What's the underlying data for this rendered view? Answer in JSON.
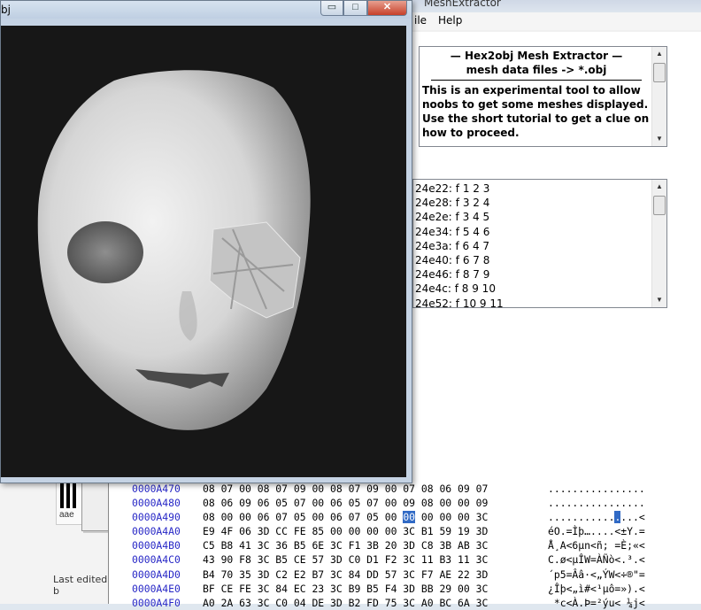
{
  "viewer": {
    "title": "bj",
    "minimize_glyph": "▭",
    "maximize_glyph": "□",
    "close_glyph": "✕"
  },
  "mesh_extractor": {
    "title": "MeshExtractor",
    "menu": {
      "file": "ile",
      "help": "Help"
    },
    "info": {
      "header_line1": "—    Hex2obj Mesh Extractor    —",
      "header_line2": "mesh data files -> *.obj",
      "body_lines": [
        "This is an experimental tool to allow",
        "noobs to get some meshes displayed.",
        "Use the short tutorial to get a clue on",
        "how to proceed."
      ]
    },
    "faces": [
      "24e22: f  1 2 3",
      "24e28: f  3 2 4",
      "24e2e: f  3 4 5",
      "24e34: f  5 4 6",
      "24e3a: f  6 4 7",
      "24e40: f  6 7 8",
      "24e46: f  8 7 9",
      "24e4c: f  8 9 10",
      "24e52: f  10 9 11"
    ]
  },
  "hex_editor": {
    "rows": [
      {
        "addr": "0000A470",
        "pre": "08 07 00 08 07 09 00 08 07 09 00 07 08 06 09 07",
        "sel": "",
        "post": "",
        "ascii_pre": "................",
        "ascii_sel": "",
        "ascii_post": ""
      },
      {
        "addr": "0000A480",
        "pre": "08 06 09 06 05 07 00 06 05 07 00 09 08 00 00 09",
        "sel": "",
        "post": "",
        "ascii_pre": "................",
        "ascii_sel": "",
        "ascii_post": ""
      },
      {
        "addr": "0000A490",
        "pre": "08 00 00 06 07 05 00 06 07 05 00 ",
        "sel": "00",
        "post": " 00 00 00 3C",
        "ascii_pre": "...........",
        "ascii_sel": ".",
        "ascii_post": "...<"
      },
      {
        "addr": "0000A4A0",
        "pre": "E9 4F 06 3D CC FE 85 00 00 00 00 3C B1 59 19 3D",
        "sel": "",
        "post": "",
        "ascii_pre": "éO.=Ìþ…....<±Y.=",
        "ascii_sel": "",
        "ascii_post": ""
      },
      {
        "addr": "0000A4B0",
        "pre": "C5 B8 41 3C 36 B5 6E 3C F1 3B 20 3D C8 3B AB 3C",
        "sel": "",
        "post": "",
        "ascii_pre": "Å¸A<6µn<ñ; =È;«<",
        "ascii_sel": "",
        "ascii_post": ""
      },
      {
        "addr": "0000A4C0",
        "pre": "43 90 F8 3C B5 CE 57 3D C0 D1 F2 3C 11 B3 11 3C",
        "sel": "",
        "post": "",
        "ascii_pre": "C.ø<µÎW=ÀÑò<.³.<",
        "ascii_sel": "",
        "ascii_post": ""
      },
      {
        "addr": "0000A4D0",
        "pre": "B4 70 35 3D C2 E2 B7 3C 84 DD 57 3C F7 AE 22 3D",
        "sel": "",
        "post": "",
        "ascii_pre": "´p5=Ââ·<„ÝW<÷®\"=",
        "ascii_sel": "",
        "ascii_post": ""
      },
      {
        "addr": "0000A4E0",
        "pre": "BF CE FE 3C 84 EC 23 3C B9 B5 F4 3D BB 29 00 3C",
        "sel": "",
        "post": "",
        "ascii_pre": "¿Îþ<„ì#<¹µô=»).<",
        "ascii_sel": "",
        "ascii_post": ""
      },
      {
        "addr": "0000A4F0",
        "pre": "A0 2A 63 3C C0 04 DE 3D B2 FD 75 3C A0 BC 6A 3C",
        "sel": "",
        "post": "",
        "ascii_pre": " *c<À.Þ=²ýu< ¼j<",
        "ascii_sel": "",
        "ascii_post": ""
      }
    ]
  },
  "background": {
    "thumb_caption": "aae",
    "last_edited": "Last edited b"
  }
}
